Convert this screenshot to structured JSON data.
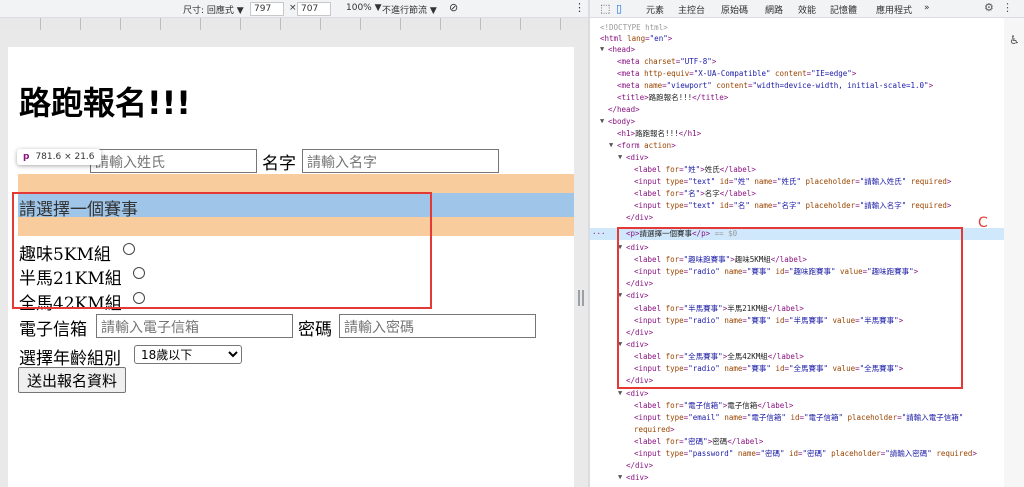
{
  "device_toolbar": {
    "size_label": "尺寸: 回應式 ▼",
    "width": "797",
    "times": "×",
    "height": "707",
    "zoom": "100% ▼",
    "throttle": "不進行節流 ▼"
  },
  "page": {
    "title": "路跑報名!!!",
    "tooltip_tag": "p",
    "tooltip_size": "781.6 × 21.6",
    "surname_placeholder": "請輸入姓氏",
    "name_label": "名字",
    "name_placeholder": "請輸入名字",
    "choose_event": "請選擇一個賽事",
    "events": [
      "趣味5KM組",
      "半馬21KM組",
      "全馬42KM組"
    ],
    "email_label": "電子信箱",
    "email_placeholder": "請輸入電子信箱",
    "password_label": "密碼",
    "password_placeholder": "請輸入密碼",
    "age_label": "選擇年齡組別",
    "age_selected": "18歲以下",
    "submit_label": "送出報名資料"
  },
  "devtools": {
    "tabs": [
      "元素",
      "主控台",
      "原始碼",
      "網路",
      "效能",
      "記憶體",
      "應用程式",
      "»"
    ],
    "annotation_letter": "C",
    "selected_suffix": "== $0",
    "ellipsis": "···"
  }
}
